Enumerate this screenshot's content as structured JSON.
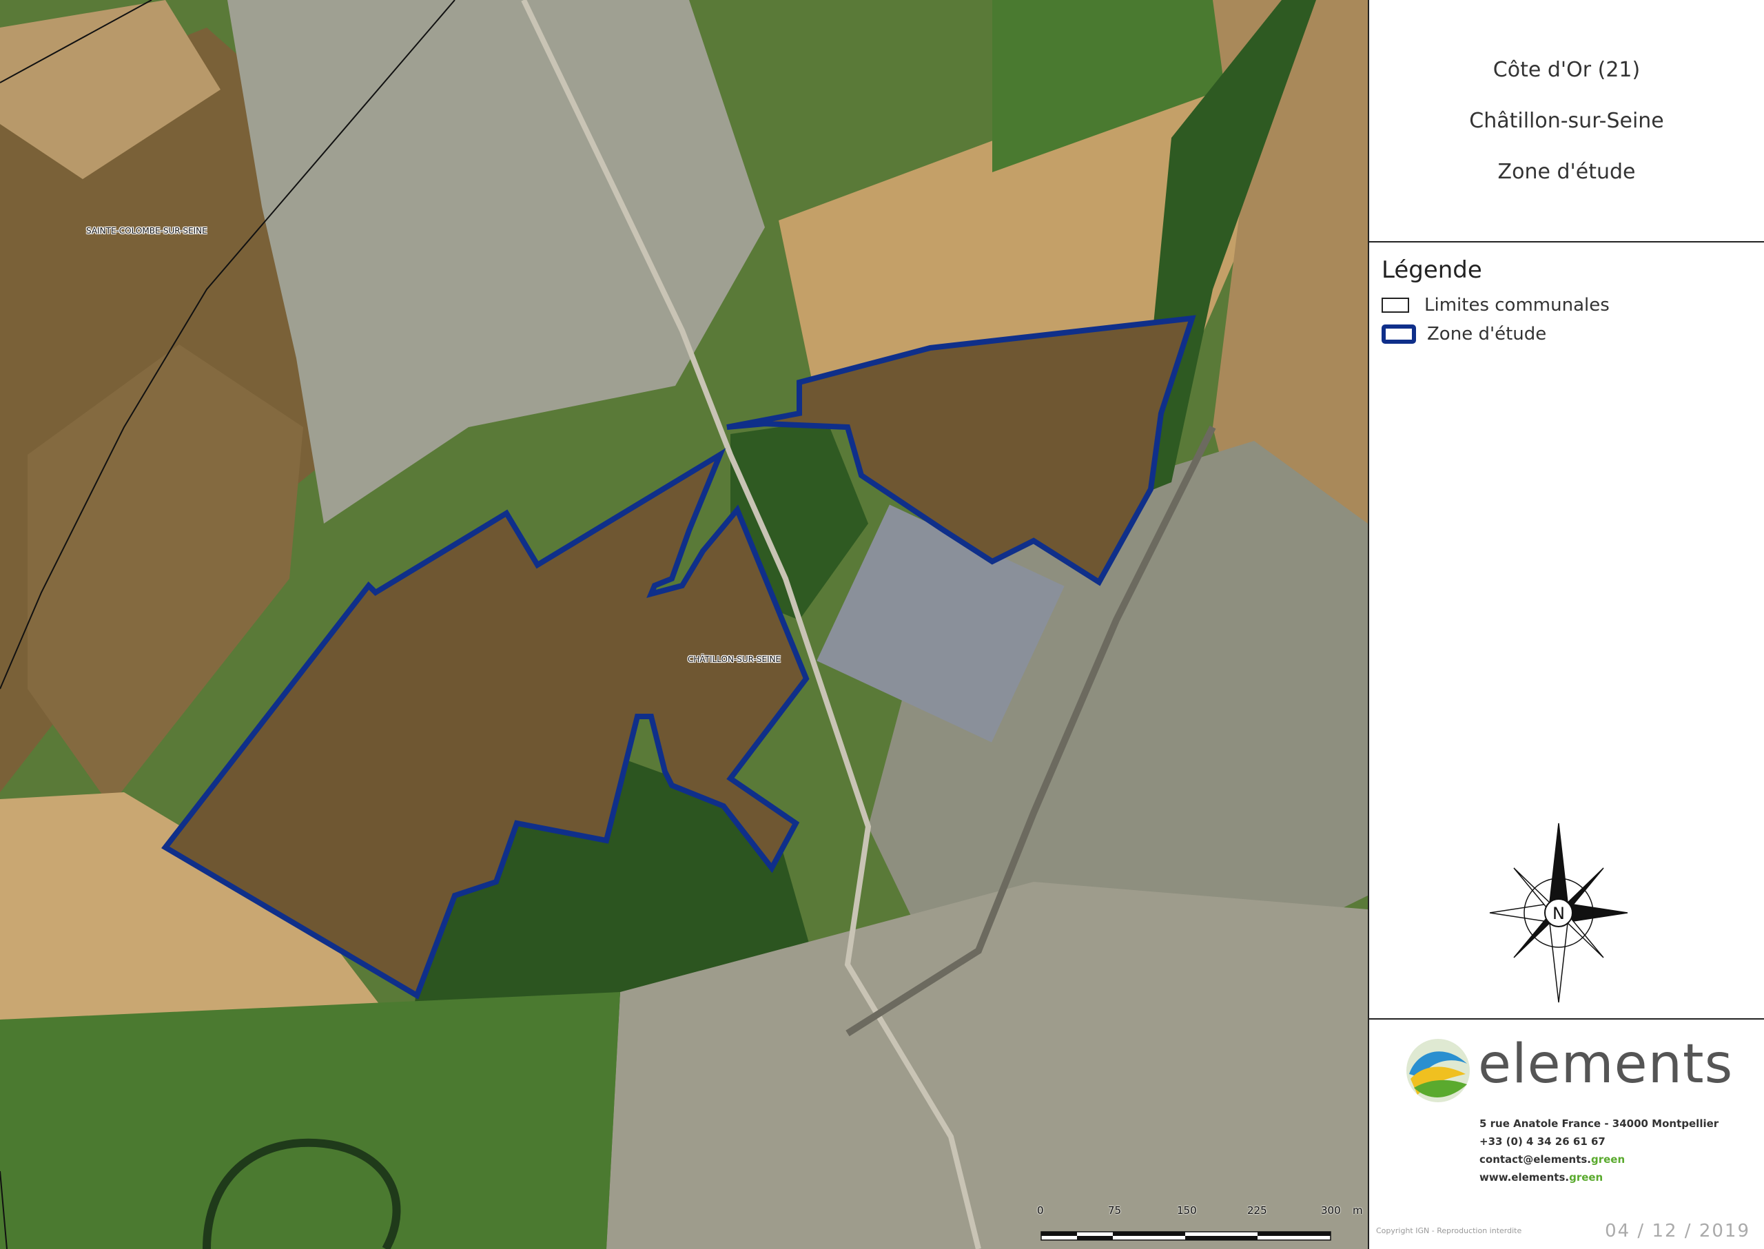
{
  "title": {
    "department": "Côte d'Or (21)",
    "commune": "Châtillon-sur-Seine",
    "subject": "Zone d'étude"
  },
  "legend": {
    "heading": "Légende",
    "items": [
      {
        "label": "Limites communales",
        "symbol": "commune-boundary",
        "color": "#222222"
      },
      {
        "label": "Zone d'étude",
        "symbol": "study-zone",
        "color": "#0f2f8a"
      }
    ]
  },
  "map_labels": {
    "commune_west": "SAINTE-COLOMBE-SUR-SEINE",
    "commune_center": "CHÂTILLON-SUR-SEINE"
  },
  "north_arrow": {
    "letter": "N"
  },
  "company": {
    "name": "elements",
    "address": "5 rue Anatole France - 34000 Montpellier",
    "phone": "+33 (0) 4 34 26 61 67",
    "email_prefix": "contact@elements.",
    "email_suffix": "green",
    "web_prefix": "www.elements.",
    "web_suffix": "green"
  },
  "copyright": "Copyright IGN - Reproduction interdite",
  "date": "04 / 12 / 2019",
  "scale": {
    "ticks": [
      "0",
      "75",
      "150",
      "225",
      "300"
    ],
    "unit": "m"
  },
  "colors": {
    "zone": "#0f2f8a",
    "field_brown": "#7a6138",
    "forest": "#2f5a22",
    "grass": "#4f7e32",
    "urban": "#a9a89a"
  }
}
